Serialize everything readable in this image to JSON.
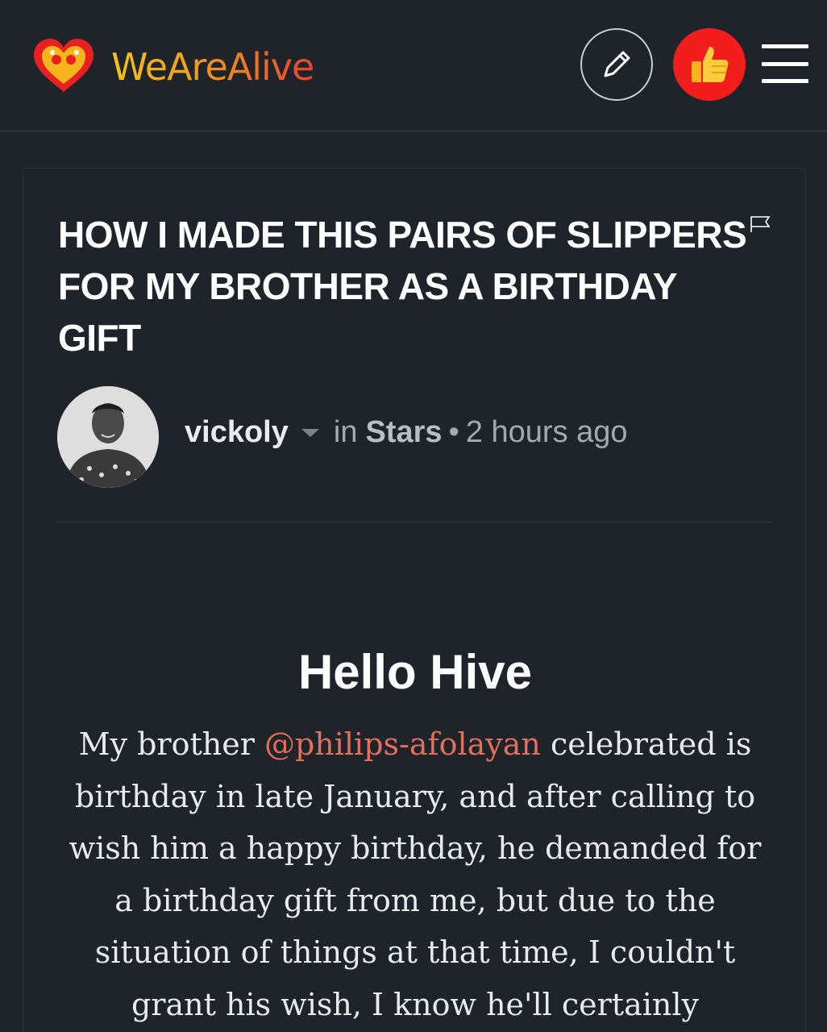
{
  "header": {
    "brand": "WeAreAlive",
    "compose_icon": "pencil-icon",
    "upvote_icon": "thumbs-up-icon",
    "menu_icon": "hamburger-menu-icon",
    "colors": {
      "background": "#1f232a",
      "upvote": "#f21e1e",
      "brand_start": "#f4c21c",
      "brand_end": "#e8432f"
    }
  },
  "post": {
    "title": "HOW I MADE THIS PAIRS OF SLIPPERS FOR MY BROTHER AS A BIRTHDAY GIFT",
    "author": "vickoly",
    "in_label": "in",
    "community": "Stars",
    "separator": "•",
    "time": "2 hours ago",
    "heading": "Hello Hive",
    "body": {
      "intro": "My brother ",
      "mention": "@philips-afolayan",
      "rest": " celebrated is birthday in late January, and after calling to wish him a happy birthday, he demanded for a birthday gift from me, but due to the situation of things at that time, I couldn't grant his wish, I know he'll certainly"
    }
  }
}
